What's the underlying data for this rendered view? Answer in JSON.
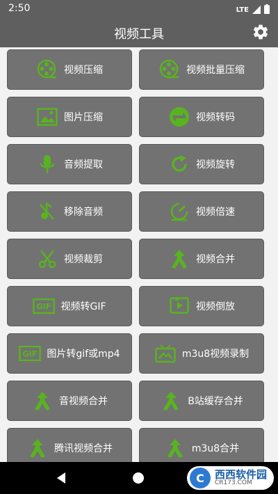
{
  "status": {
    "time": "2:50",
    "network": "LTE"
  },
  "app_bar": {
    "title": "视频工具",
    "settings_icon": "gear-icon"
  },
  "tools": [
    {
      "label": "视频压缩",
      "icon": "film-reel-icon"
    },
    {
      "label": "视频批量压缩",
      "icon": "film-reel-icon"
    },
    {
      "label": "图片压缩",
      "icon": "image-icon"
    },
    {
      "label": "视频转码",
      "icon": "transcode-icon"
    },
    {
      "label": "音频提取",
      "icon": "microphone-icon"
    },
    {
      "label": "视频旋转",
      "icon": "rotate-icon"
    },
    {
      "label": "移除音频",
      "icon": "mute-icon"
    },
    {
      "label": "视频倍速",
      "icon": "speedometer-icon"
    },
    {
      "label": "视频裁剪",
      "icon": "scissors-icon"
    },
    {
      "label": "视频合并",
      "icon": "merge-icon"
    },
    {
      "label": "视频转GIF",
      "icon": "gif-icon"
    },
    {
      "label": "视频倒放",
      "icon": "reverse-play-icon"
    },
    {
      "label": "图片转gif或mp4",
      "icon": "gif-icon"
    },
    {
      "label": "m3u8视频录制",
      "icon": "record-icon"
    },
    {
      "label": "音视频合并",
      "icon": "merge-icon"
    },
    {
      "label": "B站缓存合并",
      "icon": "merge-icon"
    },
    {
      "label": "腾讯视频合并",
      "icon": "merge-icon"
    },
    {
      "label": "m3u8合并",
      "icon": "merge-icon"
    }
  ],
  "nav": {
    "back_icon": "back-triangle-icon",
    "home_icon": "home-circle-icon"
  },
  "watermark": {
    "logo": "C",
    "name": "西西软件园",
    "url": "CR173.COM"
  },
  "colors": {
    "accent": "#59b31f",
    "tile": "#727272",
    "bar": "#5f5f5f"
  }
}
